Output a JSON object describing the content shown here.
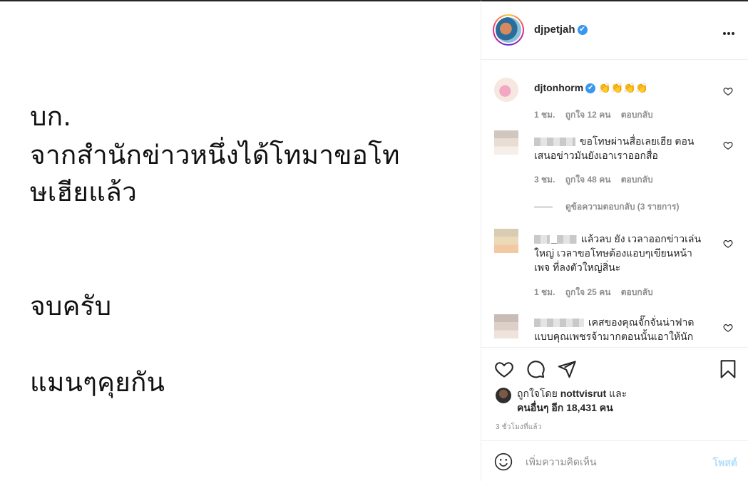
{
  "post_text": {
    "lines": [
      "บก.",
      "จากสำนักข่าวหนึ่งได้โทมาขอโท",
      "ษเฮียแล้ว",
      "จบครับ",
      "แมนๆคุยกัน"
    ]
  },
  "header": {
    "username": "djpetjah",
    "verified_glyph": "✔"
  },
  "comments": [
    {
      "username": "djtonhorm",
      "verified_glyph": "✔",
      "text": "👏👏👏👏",
      "time": "1 ชม.",
      "likes": "ถูกใจ 12 คน",
      "reply": "ตอบกลับ"
    },
    {
      "username": "",
      "text": "ขอโทษผ่านสื่อเลยเฮีย ตอนเสนอข่าวมันยังเอาเราออกสื่อ",
      "time": "3 ชม.",
      "likes": "ถูกใจ 48 คน",
      "reply": "ตอบกลับ",
      "view_replies": "ดูข้อความตอบกลับ (3 รายการ)"
    },
    {
      "username": "_",
      "text": "แล้วลบ ยัง เวลาออกข่าวเล่นใหญ่ เวลาขอโทษต้องแอบๆเขียนหน้าเพจ ที่ลงตัวใหญ่สิ่นะ",
      "time": "1 ชม.",
      "likes": "ถูกใจ 25 คน",
      "reply": "ตอบกลับ"
    },
    {
      "username": "",
      "text": "เคสของคุณจั๊กจั่นน่าฟาดแบบคุณเพชรจ้ามากตอนนั้นเอาให้นัก",
      "time": "",
      "likes": "",
      "reply": ""
    }
  ],
  "icons": {
    "like": "heart-icon",
    "comment": "comment-bubble-icon",
    "share": "paper-plane-icon",
    "save": "bookmark-icon",
    "emoji": "emoji-smile-icon",
    "more": "more-options-icon"
  },
  "likes": {
    "prefix": "ถูกใจโดย ",
    "liker": "nottvisrut",
    "conj": " และ",
    "others": "คนอื่นๆ อีก 18,431 คน"
  },
  "timestamp": "3 ชั่วโมงที่แล้ว",
  "add_comment": {
    "placeholder": "เพิ่มความคิดเห็น",
    "post_label": "โพสต์"
  },
  "colors": {
    "accent": "#3897f0",
    "post_disabled": "#b2dffc",
    "muted": "#8e8e8e"
  }
}
